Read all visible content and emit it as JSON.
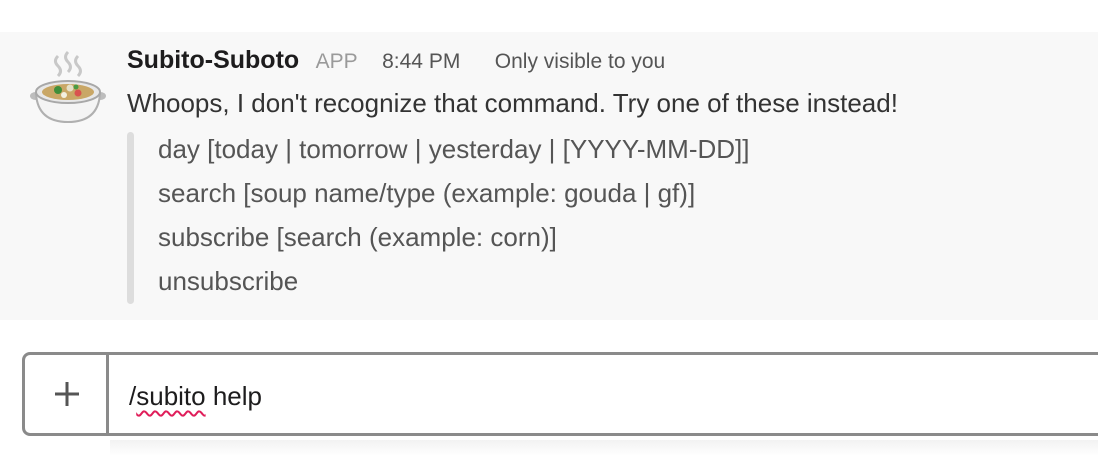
{
  "message": {
    "bot_name": "Subito-Suboto",
    "app_badge": "APP",
    "timestamp": "8:44 PM",
    "visibility": "Only visible to you",
    "avatar_icon": "soup-pot-icon",
    "intro": "Whoops, I don't recognize that command. Try one of these instead!",
    "commands": [
      "day [today | tomorrow | yesterday | [YYYY-MM-DD]]",
      "search [soup name/type (example: gouda | gf)]",
      "subscribe [search (example: corn)]",
      "unsubscribe"
    ]
  },
  "composer": {
    "plus_icon": "plus-icon",
    "input_prefix": "/",
    "input_misspelled": "subito",
    "input_suffix": " help"
  }
}
